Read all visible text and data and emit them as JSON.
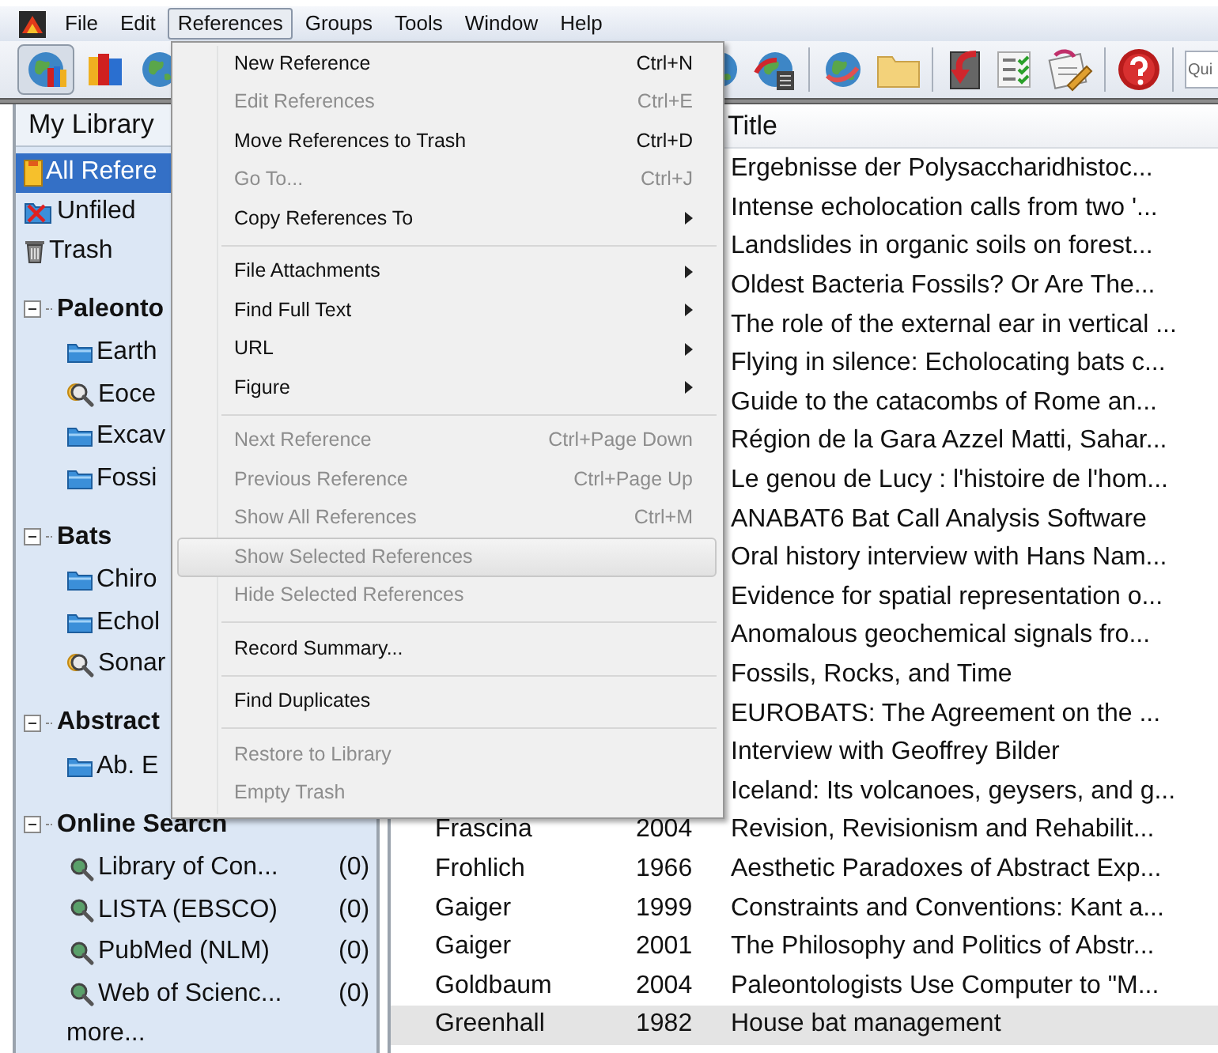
{
  "menubar": [
    {
      "label": "File",
      "selected": false
    },
    {
      "label": "Edit",
      "selected": false
    },
    {
      "label": "References",
      "selected": true
    },
    {
      "label": "Groups",
      "selected": false
    },
    {
      "label": "Tools",
      "selected": false
    },
    {
      "label": "Window",
      "selected": false
    },
    {
      "label": "Help",
      "selected": false
    }
  ],
  "toolbar": {
    "quick_search": {
      "placeholder": "Qui"
    }
  },
  "references_menu": {
    "items": [
      {
        "kind": "item",
        "label": "New Reference",
        "shortcut": "Ctrl+N",
        "disabled": false,
        "selected": false
      },
      {
        "kind": "item",
        "label": "Edit References",
        "shortcut": "Ctrl+E",
        "disabled": true,
        "selected": false
      },
      {
        "kind": "item",
        "label": "Move References to Trash",
        "shortcut": "Ctrl+D",
        "disabled": false,
        "selected": false
      },
      {
        "kind": "item",
        "label": "Go To...",
        "shortcut": "Ctrl+J",
        "disabled": true,
        "selected": false
      },
      {
        "kind": "submenu",
        "label": "Copy References To",
        "disabled": false,
        "selected": false
      },
      {
        "kind": "separator"
      },
      {
        "kind": "submenu",
        "label": "File Attachments",
        "disabled": false,
        "selected": false
      },
      {
        "kind": "submenu",
        "label": "Find Full Text",
        "disabled": false,
        "selected": false
      },
      {
        "kind": "submenu",
        "label": "URL",
        "disabled": false,
        "selected": false
      },
      {
        "kind": "submenu",
        "label": "Figure",
        "disabled": false,
        "selected": false
      },
      {
        "kind": "separator"
      },
      {
        "kind": "item",
        "label": "Next Reference",
        "shortcut": "Ctrl+Page Down",
        "disabled": true,
        "selected": false
      },
      {
        "kind": "item",
        "label": "Previous Reference",
        "shortcut": "Ctrl+Page Up",
        "disabled": true,
        "selected": false
      },
      {
        "kind": "item",
        "label": "Show All References",
        "shortcut": "Ctrl+M",
        "disabled": true,
        "selected": false
      },
      {
        "kind": "item",
        "label": "Show Selected References",
        "disabled": true,
        "selected": true
      },
      {
        "kind": "item",
        "label": "Hide Selected References",
        "disabled": true,
        "selected": false
      },
      {
        "kind": "separator"
      },
      {
        "kind": "item",
        "label": "Record Summary...",
        "disabled": false,
        "selected": false
      },
      {
        "kind": "separator"
      },
      {
        "kind": "item",
        "label": "Find Duplicates",
        "disabled": false,
        "selected": false
      },
      {
        "kind": "separator"
      },
      {
        "kind": "item",
        "label": "Restore to Library",
        "disabled": true,
        "selected": false
      },
      {
        "kind": "item",
        "label": "Empty Trash",
        "disabled": true,
        "selected": false
      }
    ]
  },
  "sidebar": {
    "header": "My Library",
    "library": [
      {
        "kind": "all",
        "label": "All Refere",
        "selected": true
      },
      {
        "kind": "unfiled",
        "label": "Unfiled",
        "selected": false
      },
      {
        "kind": "trash",
        "label": "Trash",
        "selected": false
      }
    ],
    "groups": [
      {
        "title": "Paleonto",
        "expanded": true,
        "children": [
          {
            "kind": "group",
            "label": "Earth"
          },
          {
            "kind": "smart",
            "label": "Eoce"
          },
          {
            "kind": "group",
            "label": "Excav"
          },
          {
            "kind": "group",
            "label": "Fossi"
          }
        ]
      },
      {
        "title": "Bats",
        "expanded": true,
        "children": [
          {
            "kind": "group",
            "label": "Chiro"
          },
          {
            "kind": "group",
            "label": "Echol"
          },
          {
            "kind": "smart",
            "label": "Sonar"
          }
        ]
      },
      {
        "title": "Abstract",
        "expanded": true,
        "children": [
          {
            "kind": "group",
            "label": "Ab. E"
          }
        ]
      },
      {
        "title": "Online Search",
        "expanded": true,
        "children": [
          {
            "kind": "online",
            "label": "Library of Con...",
            "count": "(0)"
          },
          {
            "kind": "online",
            "label": "LISTA (EBSCO)",
            "count": "(0)"
          },
          {
            "kind": "online",
            "label": "PubMed (NLM)",
            "count": "(0)"
          },
          {
            "kind": "online",
            "label": "Web of Scienc...",
            "count": "(0)"
          }
        ]
      }
    ],
    "more": "more..."
  },
  "table": {
    "columns": [
      {
        "label": "Title"
      }
    ],
    "rows": [
      {
        "title": "Ergebnisse der Polysaccharidhistoc...",
        "selected": false
      },
      {
        "title": "Intense echolocation calls from two '...",
        "selected": false
      },
      {
        "title": "Landslides in organic soils on forest...",
        "selected": false
      },
      {
        "title": "Oldest Bacteria Fossils? Or Are The...",
        "selected": false
      },
      {
        "title": "The role of the external ear in vertical ...",
        "selected": false
      },
      {
        "title": "Flying in silence: Echolocating bats c...",
        "selected": false
      },
      {
        "title": "Guide to the catacombs of Rome an...",
        "selected": false
      },
      {
        "title": "Région de la Gara Azzel Matti, Sahar...",
        "selected": false
      },
      {
        "title": "Le genou de Lucy : l'histoire de l'hom...",
        "selected": false
      },
      {
        "title": "ANABAT6 Bat Call Analysis Software",
        "selected": false
      },
      {
        "title": "Oral history interview with Hans Nam...",
        "selected": false
      },
      {
        "title": "Evidence for spatial representation o...",
        "selected": false
      },
      {
        "title": "Anomalous geochemical signals fro...",
        "selected": false
      },
      {
        "title": "Fossils, Rocks, and Time",
        "selected": false
      },
      {
        "title": "EUROBATS: The Agreement on the ...",
        "selected": false
      },
      {
        "title": "Interview with Geoffrey Bilder",
        "selected": false
      },
      {
        "title": "Iceland: Its volcanoes, geysers, and g...",
        "selected": false
      },
      {
        "author": "Frascina",
        "year": "2004",
        "title": "Revision, Revisionism and Rehabilit...",
        "selected": false
      },
      {
        "author": "Frohlich",
        "year": "1966",
        "title": "Aesthetic Paradoxes of Abstract Exp...",
        "selected": false
      },
      {
        "author": "Gaiger",
        "year": "1999",
        "title": "Constraints and Conventions: Kant a...",
        "selected": false
      },
      {
        "author": "Gaiger",
        "year": "2001",
        "title": "The Philosophy and Politics of Abstr...",
        "selected": false
      },
      {
        "author": "Goldbaum",
        "year": "2004",
        "title": "Paleontologists Use Computer to \"M...",
        "selected": false
      },
      {
        "author": "Greenhall",
        "year": "1982",
        "title": "House bat management",
        "selected": true
      }
    ]
  }
}
